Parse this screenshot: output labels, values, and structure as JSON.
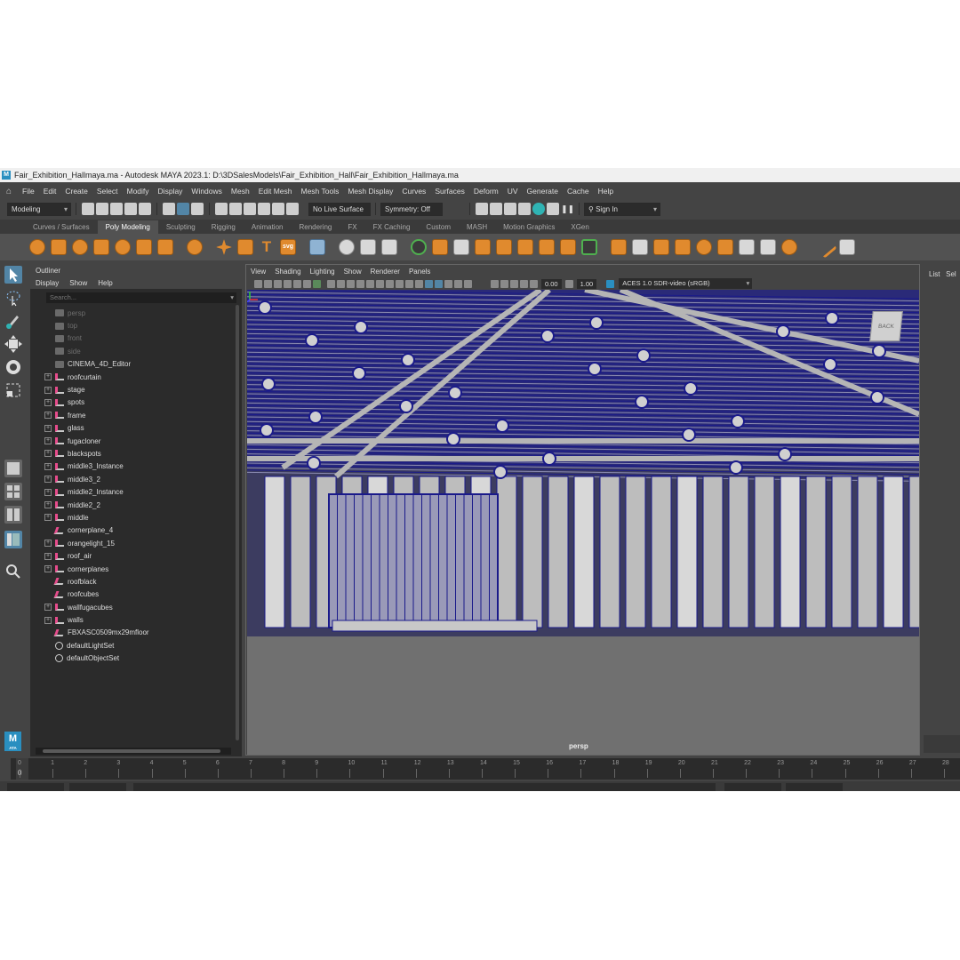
{
  "window": {
    "title": "Fair_Exhibition_Hallmaya.ma - Autodesk MAYA 2023.1: D:\\3DSalesModels\\Fair_Exhibition_Hall\\Fair_Exhibition_Hallmaya.ma",
    "logo": "M"
  },
  "menubar": {
    "items": [
      "File",
      "Edit",
      "Create",
      "Select",
      "Modify",
      "Display",
      "Windows",
      "Mesh",
      "Edit Mesh",
      "Mesh Tools",
      "Mesh Display",
      "Curves",
      "Surfaces",
      "Deform",
      "UV",
      "Generate",
      "Cache",
      "Help"
    ]
  },
  "statusline": {
    "menuset": "Modeling",
    "live_surface": "No Live Surface",
    "symmetry": "Symmetry: Off",
    "sign_in": "Sign In"
  },
  "shelf": {
    "tabs": [
      "Curves / Surfaces",
      "Poly Modeling",
      "Sculpting",
      "Rigging",
      "Animation",
      "Rendering",
      "FX",
      "FX Caching",
      "Custom",
      "MASH",
      "Motion Graphics",
      "XGen"
    ],
    "active_tab": "Poly Modeling",
    "text_icon": "T",
    "svg_icon": "svg"
  },
  "outliner": {
    "tab": "Outliner",
    "menu": [
      "Display",
      "Show",
      "Help"
    ],
    "search_placeholder": "Search...",
    "items": [
      {
        "label": "persp",
        "type": "cam",
        "dim": true,
        "expandable": false
      },
      {
        "label": "top",
        "type": "cam",
        "dim": true,
        "expandable": false
      },
      {
        "label": "front",
        "type": "cam",
        "dim": true,
        "expandable": false
      },
      {
        "label": "side",
        "type": "cam",
        "dim": true,
        "expandable": false
      },
      {
        "label": "CINEMA_4D_Editor",
        "type": "cam",
        "dim": false,
        "expandable": false
      },
      {
        "label": "roofcurtain",
        "type": "grp",
        "dim": false,
        "expandable": true
      },
      {
        "label": "stage",
        "type": "grp",
        "dim": false,
        "expandable": true
      },
      {
        "label": "spots",
        "type": "grp",
        "dim": false,
        "expandable": true
      },
      {
        "label": "frame",
        "type": "grp",
        "dim": false,
        "expandable": true
      },
      {
        "label": "glass",
        "type": "grp",
        "dim": false,
        "expandable": true
      },
      {
        "label": "fugacloner",
        "type": "grp",
        "dim": false,
        "expandable": true
      },
      {
        "label": "blackspots",
        "type": "grp",
        "dim": false,
        "expandable": true
      },
      {
        "label": "middle3_Instance",
        "type": "grp",
        "dim": false,
        "expandable": true
      },
      {
        "label": "middle3_2",
        "type": "grp",
        "dim": false,
        "expandable": true
      },
      {
        "label": "middle2_Instance",
        "type": "grp",
        "dim": false,
        "expandable": true
      },
      {
        "label": "middle2_2",
        "type": "grp",
        "dim": false,
        "expandable": true
      },
      {
        "label": "middle",
        "type": "grp",
        "dim": false,
        "expandable": true
      },
      {
        "label": "cornerplane_4",
        "type": "mesh",
        "dim": false,
        "expandable": false
      },
      {
        "label": "orangelight_15",
        "type": "grp",
        "dim": false,
        "expandable": true
      },
      {
        "label": "roof_air",
        "type": "grp",
        "dim": false,
        "expandable": true
      },
      {
        "label": "cornerplanes",
        "type": "grp",
        "dim": false,
        "expandable": true
      },
      {
        "label": "roofblack",
        "type": "mesh",
        "dim": false,
        "expandable": false
      },
      {
        "label": "roofcubes",
        "type": "mesh",
        "dim": false,
        "expandable": false
      },
      {
        "label": "wallfugacubes",
        "type": "grp",
        "dim": false,
        "expandable": true
      },
      {
        "label": "walls",
        "type": "grp",
        "dim": false,
        "expandable": true
      },
      {
        "label": "FBXASC0509mx29mfloor",
        "type": "mesh",
        "dim": false,
        "expandable": false
      },
      {
        "label": "defaultLightSet",
        "type": "set",
        "dim": false,
        "expandable": false
      },
      {
        "label": "defaultObjectSet",
        "type": "set",
        "dim": false,
        "expandable": false
      }
    ]
  },
  "viewport": {
    "menu": [
      "View",
      "Shading",
      "Lighting",
      "Show",
      "Renderer",
      "Panels"
    ],
    "exposure": "0.00",
    "gamma": "1.00",
    "color_space": "ACES 1.0 SDR-video (sRGB)",
    "camera_label": "persp",
    "viewcube_label": "BACK",
    "wire_color": "#1a1a8a",
    "background_color": "#6e6e6e"
  },
  "right_panel": {
    "items": [
      "List",
      "Sel"
    ]
  },
  "badge": {
    "letter": "M",
    "sub": "ATA"
  },
  "timeslider": {
    "ticks": [
      "0",
      "1",
      "2",
      "3",
      "4",
      "5",
      "6",
      "7",
      "8",
      "9",
      "10",
      "11",
      "12",
      "13",
      "14",
      "15",
      "16",
      "17",
      "18",
      "19",
      "20",
      "21",
      "22",
      "23",
      "24",
      "25",
      "26",
      "27",
      "28"
    ],
    "current_frame": "0"
  }
}
